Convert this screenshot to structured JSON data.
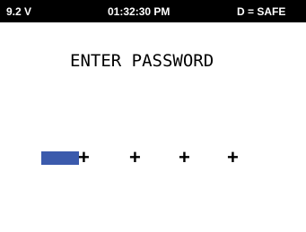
{
  "status_bar": {
    "voltage": "9.2 V",
    "time": "01:32:30 PM",
    "mode": "D = SAFE"
  },
  "prompt": {
    "title": "ENTER PASSWORD"
  },
  "password": {
    "digits": [
      "+",
      "+",
      "+",
      "+"
    ],
    "cursor_color": "#3b5aac"
  }
}
